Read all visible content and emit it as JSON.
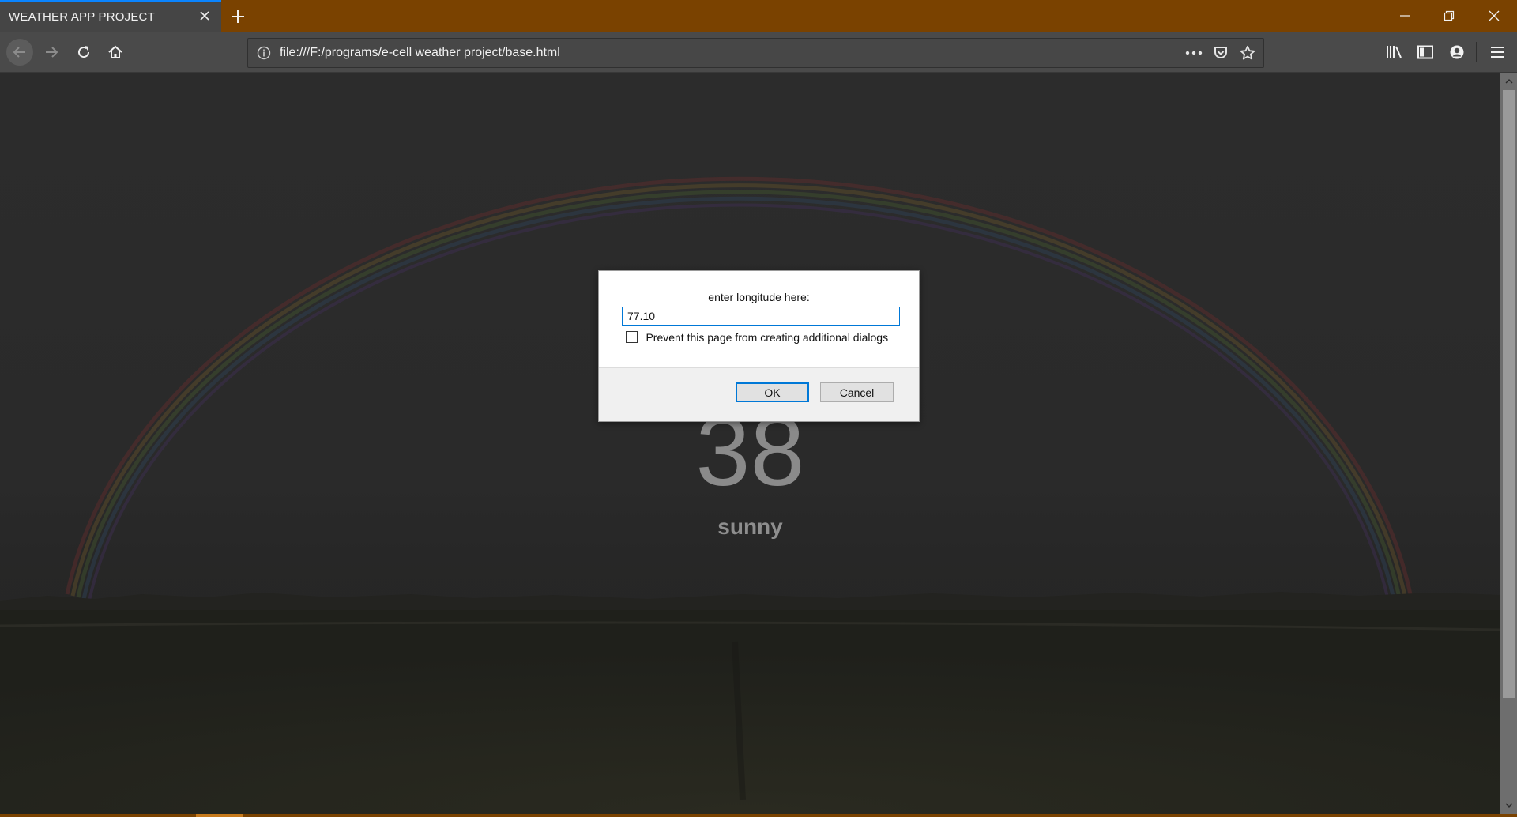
{
  "browser": {
    "tab": {
      "title": "WEATHER APP PROJECT"
    },
    "url": "file:///F:/programs/e-cell weather project/base.html",
    "icons": {
      "tab_close": "close-icon",
      "new_tab": "plus-icon",
      "back": "arrow-left-icon",
      "forward": "arrow-right-icon",
      "reload": "reload-icon",
      "home": "home-icon",
      "page_info": "info-icon",
      "page_actions": "more-dots-icon",
      "pocket": "pocket-icon",
      "bookmark": "star-icon",
      "library": "library-icon",
      "sidebar": "sidebar-icon",
      "account": "account-icon",
      "menu": "hamburger-menu-icon",
      "minimize": "minimize-icon",
      "restore": "restore-icon",
      "close_window": "close-icon"
    }
  },
  "page": {
    "temperature": "38",
    "description": "sunny"
  },
  "dialog": {
    "message": "enter longitude here:",
    "input_value": "77.10",
    "checkbox_label": "Prevent this page from creating additional dialogs",
    "checkbox_checked": false,
    "ok_label": "OK",
    "cancel_label": "Cancel"
  },
  "colors": {
    "titlebar": "#7a4200",
    "active_tab": "#454545",
    "tab_accent": "#0a84ff",
    "toolbar": "#4a4a4a",
    "dialog_focus": "#0078d7"
  }
}
